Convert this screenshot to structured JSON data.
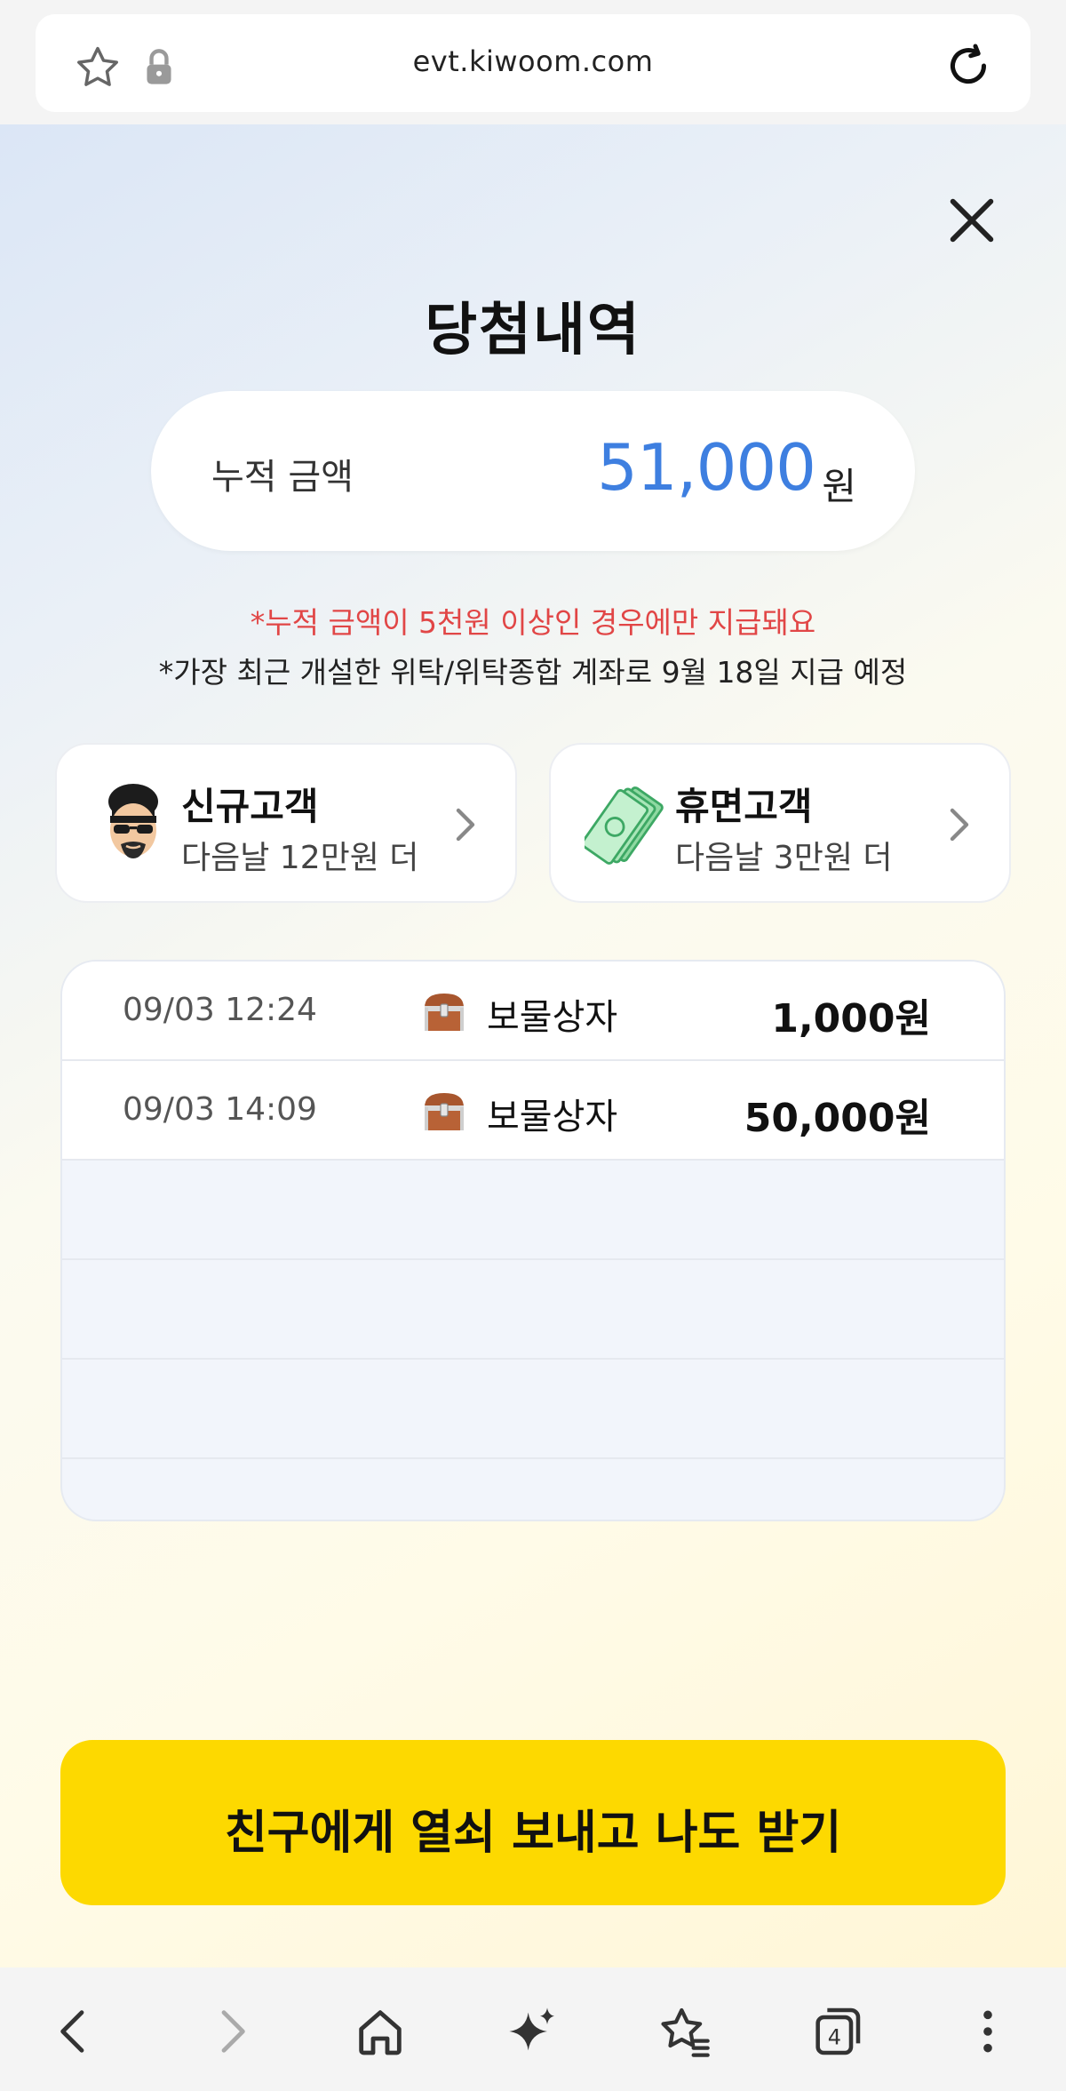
{
  "browser": {
    "url": "evt.kiwoom.com",
    "tab_count": "4"
  },
  "modal": {
    "title": "당첨내역",
    "total": {
      "label": "누적 금액",
      "amount": "51,000",
      "unit": "원"
    },
    "notices": {
      "warning": "*누적 금액이 5천원 이상인 경우에만 지급돼요",
      "info": "*가장 최근 개설한 위탁/위탁종합 계좌로 9월 18일 지급 예정"
    },
    "cards": [
      {
        "title": "신규고객",
        "subtitle": "다음날 12만원 더"
      },
      {
        "title": "휴면고객",
        "subtitle": "다음날 3만원 더"
      }
    ],
    "history": [
      {
        "time": "09/03 12:24",
        "prize": "보물상자",
        "amount": "1,000원"
      },
      {
        "time": "09/03 14:09",
        "prize": "보물상자",
        "amount": "50,000원"
      }
    ],
    "cta_label": "친구에게 열쇠 보내고 나도 받기"
  },
  "colors": {
    "accent_blue": "#3e7fe0",
    "warning_red": "#e14646",
    "cta_yellow": "#fdd900"
  },
  "icons": {
    "bookmark": "star-icon",
    "secure": "lock-icon",
    "reload": "reload-icon",
    "close": "close-icon",
    "new_customer": "avatar-icon",
    "dormant_customer": "money-icon",
    "chest": "treasure-chest-icon"
  }
}
